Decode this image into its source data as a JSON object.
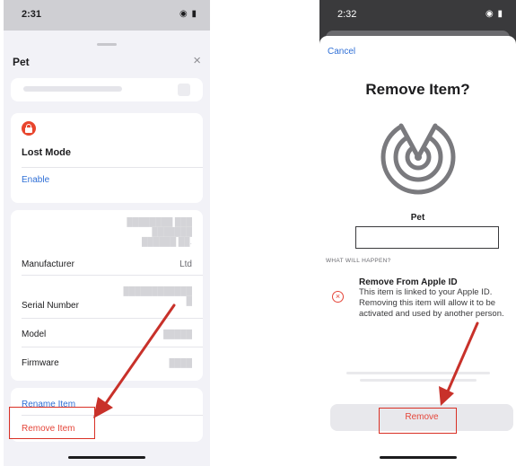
{
  "left_screen": {
    "status": {
      "time": "2:31",
      "icons": "◉ ▮"
    },
    "sheet": {
      "title": "Pet",
      "close_glyph": "×"
    },
    "lost_mode": {
      "label": "Lost Mode",
      "enable_label": "Enable"
    },
    "details": {
      "manufacturer_label": "Manufacturer",
      "manufacturer_value_visible": "Ltd",
      "serial_label": "Serial Number",
      "model_label": "Model",
      "firmware_label": "Firmware"
    },
    "actions": {
      "rename_label": "Rename Item",
      "remove_label": "Remove Item"
    }
  },
  "right_screen": {
    "status": {
      "time": "2:32",
      "icons": "◉ ▮"
    },
    "cancel_label": "Cancel",
    "title": "Remove Item?",
    "item_name": "Pet",
    "what_heading": "WHAT WILL HAPPEN?",
    "consequence": {
      "title": "Remove From Apple ID",
      "description": "This item is linked to your Apple ID. Removing this item will allow it to be activated and used by another person."
    },
    "remove_button_label": "Remove"
  },
  "colors": {
    "accent_blue": "#2f6fd6",
    "destructive_red": "#e5463a",
    "annotation_red": "#c8312a"
  }
}
